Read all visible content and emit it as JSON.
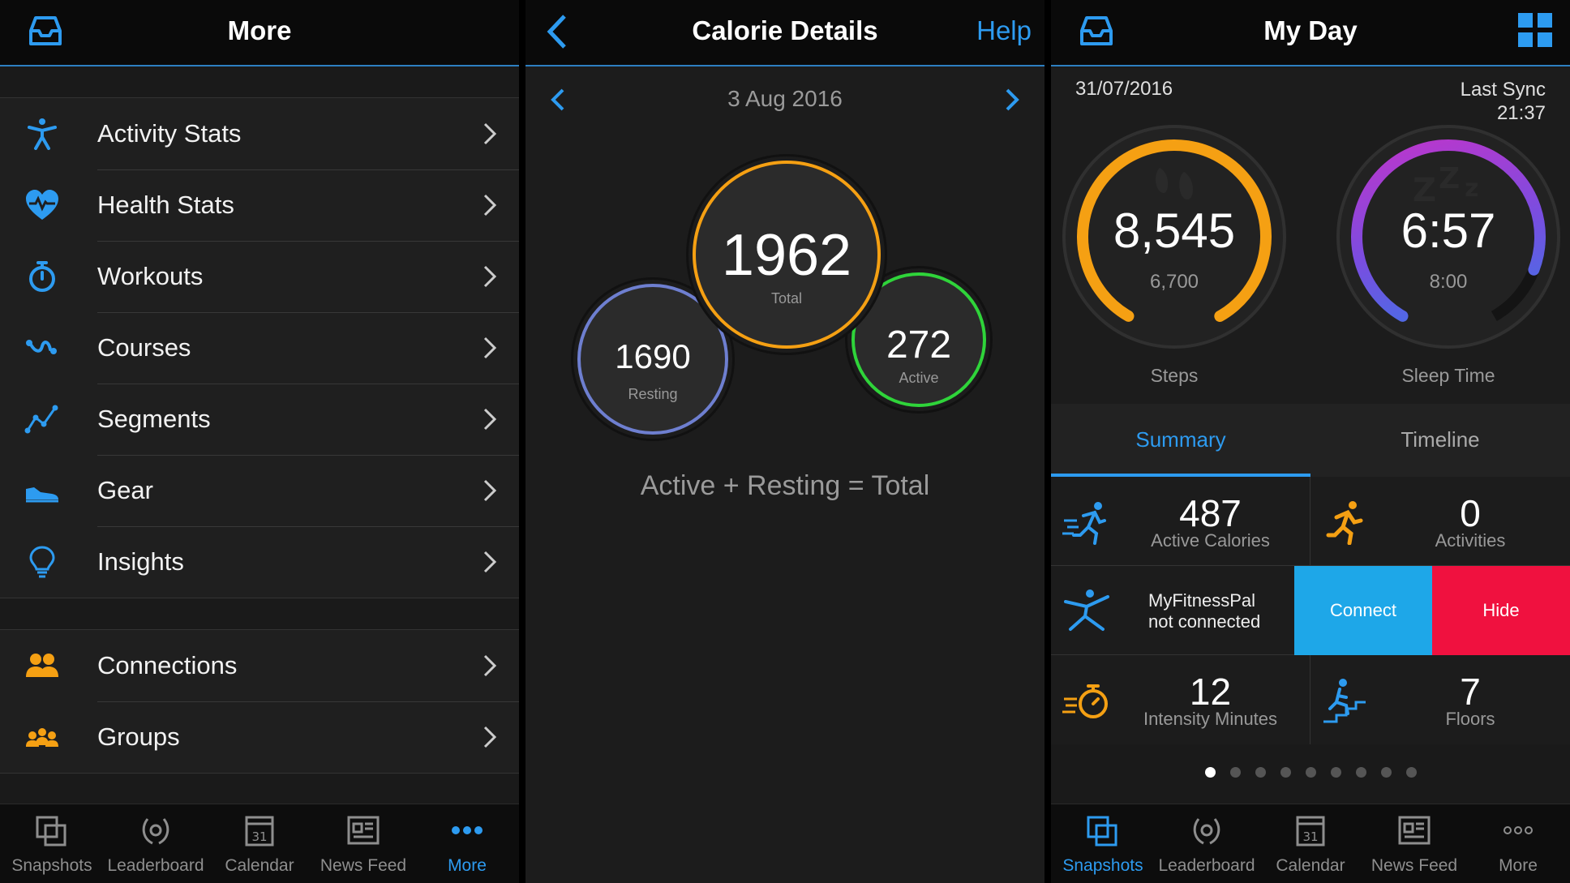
{
  "more_screen": {
    "title": "More",
    "menu_items": [
      {
        "label": "Activity Stats",
        "icon": "activity-icon"
      },
      {
        "label": "Health Stats",
        "icon": "heart-icon"
      },
      {
        "label": "Workouts",
        "icon": "stopwatch-icon"
      },
      {
        "label": "Courses",
        "icon": "course-icon"
      },
      {
        "label": "Segments",
        "icon": "segments-icon"
      },
      {
        "label": "Gear",
        "icon": "shoe-icon"
      },
      {
        "label": "Insights",
        "icon": "lightbulb-icon"
      }
    ],
    "menu_items_2": [
      {
        "label": "Connections",
        "icon": "people-icon"
      },
      {
        "label": "Groups",
        "icon": "group-icon"
      }
    ],
    "active_tab": "More"
  },
  "calorie_screen": {
    "title": "Calorie Details",
    "help_label": "Help",
    "date": "3 Aug 2016",
    "total": {
      "value": "1962",
      "label": "Total"
    },
    "resting": {
      "value": "1690",
      "label": "Resting"
    },
    "active": {
      "value": "272",
      "label": "Active"
    },
    "formula": "Active + Resting = Total"
  },
  "myday_screen": {
    "title": "My Day",
    "date": "31/07/2016",
    "sync_label": "Last Sync",
    "sync_time": "21:37",
    "steps": {
      "value": "8,545",
      "goal": "6,700",
      "label": "Steps",
      "progress": 1.0
    },
    "sleep": {
      "value": "6:57",
      "goal": "8:00",
      "label": "Sleep Time",
      "progress": 0.87
    },
    "tabs": [
      "Summary",
      "Timeline"
    ],
    "active_calories": {
      "value": "487",
      "label": "Active Calories"
    },
    "activities": {
      "value": "0",
      "label": "Activities"
    },
    "mfp": {
      "line1": "MyFitnessPal",
      "line2": "not connected",
      "connect": "Connect",
      "hide": "Hide"
    },
    "intensity": {
      "value": "12",
      "label": "Intensity Minutes"
    },
    "floors": {
      "value": "7",
      "label": "Floors"
    },
    "page_count": 9,
    "active_page": 1,
    "active_tab": "Snapshots"
  },
  "tabbar": [
    "Snapshots",
    "Leaderboard",
    "Calendar",
    "News Feed",
    "More"
  ],
  "colors": {
    "accent": "#2d9bf0",
    "orange": "#f5a013",
    "green": "#2fd43a",
    "connect": "#1ea7e8",
    "hide": "#f0113f"
  }
}
